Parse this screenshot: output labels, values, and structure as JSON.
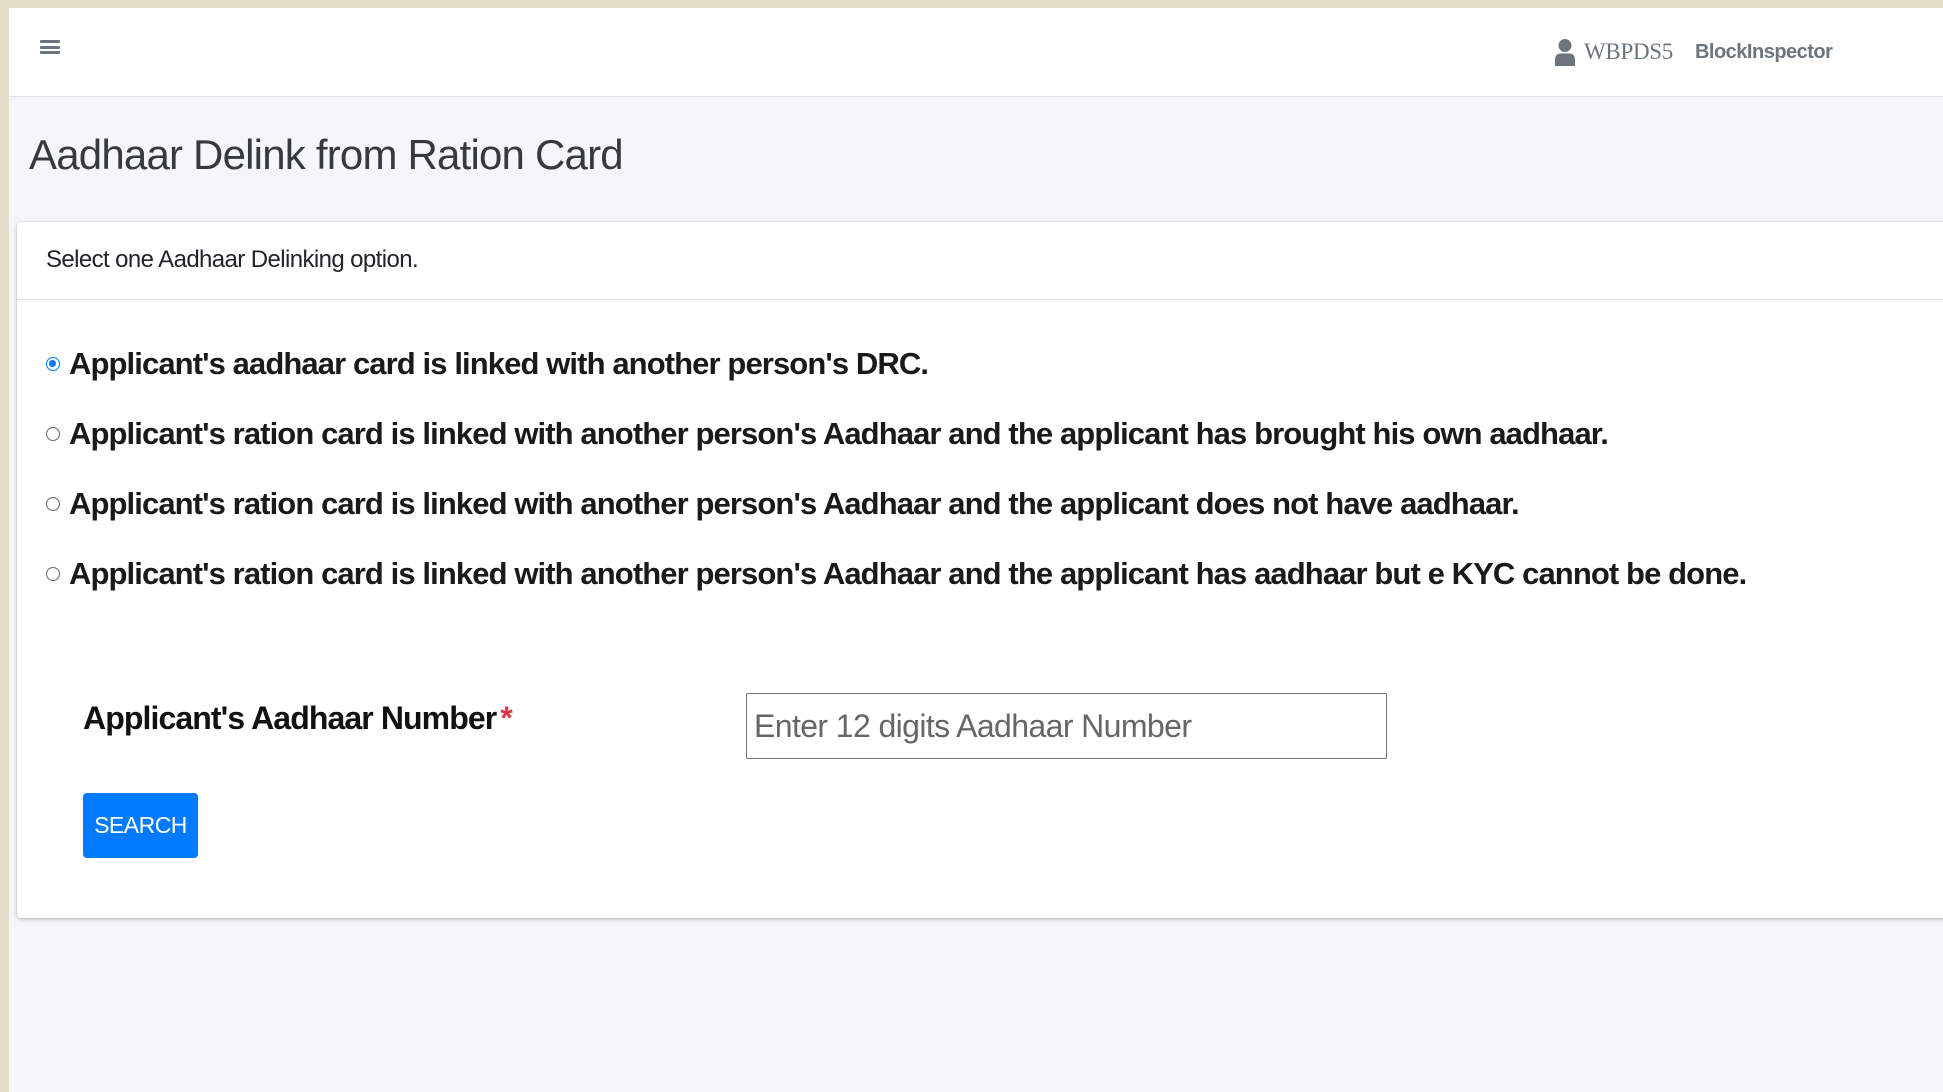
{
  "navbar": {
    "menu_icon": "hamburger-menu-icon",
    "user_icon": "user-icon",
    "user_name": "WBPDS5",
    "user_role": "BlockInspector"
  },
  "page": {
    "title": "Aadhaar Delink from Ration Card"
  },
  "card": {
    "header": "Select one Aadhaar Delinking option.",
    "options": [
      {
        "label": "Applicant's aadhaar card is linked with another person's DRC.",
        "checked": true
      },
      {
        "label": "Applicant's ration card is linked with another person's Aadhaar and the applicant has brought his own aadhaar.",
        "checked": false
      },
      {
        "label": "Applicant's ration card is linked with another person's Aadhaar and the applicant does not have aadhaar.",
        "checked": false
      },
      {
        "label": "Applicant's ration card is linked with another person's Aadhaar and the applicant has aadhaar but e KYC cannot be done.",
        "checked": false
      }
    ],
    "aadhaar_field": {
      "label": "Applicant's Aadhaar Number",
      "required_mark": "*",
      "value": "",
      "placeholder": "Enter 12 digits Aadhaar Number"
    },
    "search_button": "SEARCH"
  },
  "colors": {
    "primary": "#007bff",
    "radio_accent": "#0075ff",
    "required": "#dc3545",
    "background": "#f4f6f9",
    "outer_frame": "#e3dec8"
  }
}
